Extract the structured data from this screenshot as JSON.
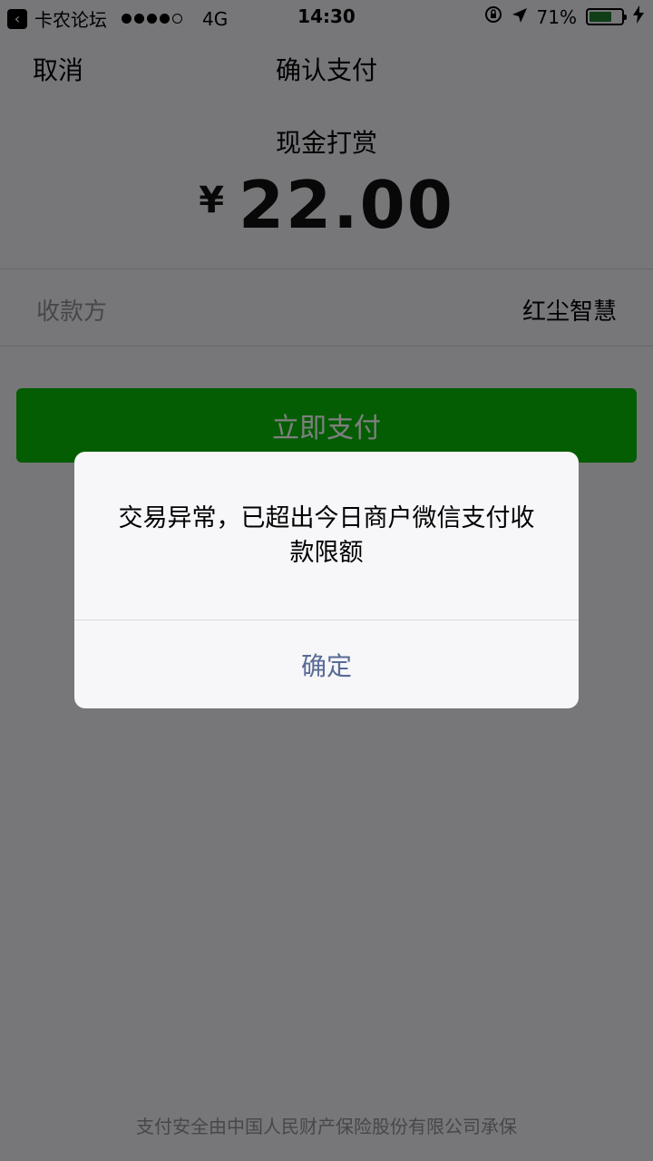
{
  "status_bar": {
    "carrier": "卡农论坛",
    "network": "4G",
    "time": "14:30",
    "battery_text": "71%",
    "battery_level": 0.71,
    "icons": [
      "back-app-icon",
      "lock-rotation-icon",
      "location-arrow-icon",
      "battery-icon",
      "charging-bolt-icon"
    ]
  },
  "nav": {
    "cancel_label": "取消",
    "title": "确认支付"
  },
  "payment": {
    "title": "现金打赏",
    "currency_symbol": "¥",
    "amount": "22.00"
  },
  "payee": {
    "label": "收款方",
    "value": "红尘智慧"
  },
  "pay_button": {
    "label": "立即支付",
    "color": "#09bb07"
  },
  "footer": {
    "text": "支付安全由中国人民财产保险股份有限公司承保"
  },
  "alert": {
    "message": "交易异常，已超出今日商户微信支付收款限额",
    "confirm_label": "确定",
    "confirm_color": "#576b95"
  }
}
